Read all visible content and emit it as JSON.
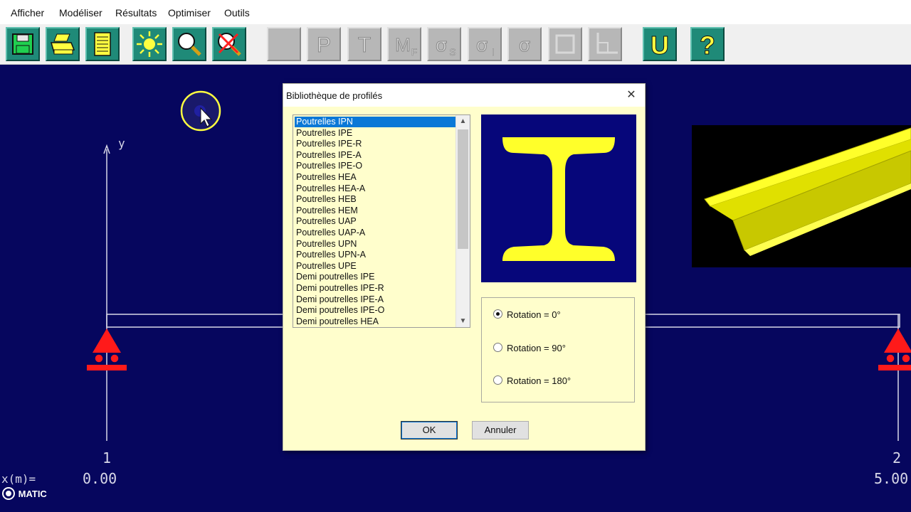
{
  "menu": {
    "items": [
      "Afficher",
      "Modéliser",
      "Résultats",
      "Optimiser",
      "Outils"
    ]
  },
  "toolbar": {
    "buttons": [
      "save-icon",
      "print-icon",
      "notes-icon",
      "sun-icon",
      "zoom-icon",
      "delete-zoom-icon",
      "blank-icon",
      "P",
      "T",
      "MF",
      "σS",
      "σI",
      "σ",
      "section-icon",
      "axes-icon",
      "U",
      "?"
    ]
  },
  "canvas": {
    "axis_label": "y",
    "node_left": "1",
    "node_right": "2",
    "x_label": "x(m)=",
    "x_left": "0.00",
    "x_right": "5.00",
    "badge": "MATIC"
  },
  "dialog": {
    "title": "Bibliothèque de profilés",
    "close": "✕",
    "profiles": [
      "Poutrelles IPN",
      "Poutrelles IPE",
      "Poutrelles IPE-R",
      "Poutrelles IPE-A",
      "Poutrelles IPE-O",
      "Poutrelles HEA",
      "Poutrelles HEA-A",
      "Poutrelles HEB",
      "Poutrelles HEM",
      "Poutrelles UAP",
      "Poutrelles UAP-A",
      "Poutrelles UPN",
      "Poutrelles UPN-A",
      "Poutrelles UPE",
      "Demi poutrelles IPE",
      "Demi poutrelles IPE-R",
      "Demi poutrelles IPE-A",
      "Demi poutrelles IPE-O",
      "Demi poutrelles HEA"
    ],
    "selected_profile": "Poutrelles IPN",
    "rotations": [
      "Rotation = 0°",
      "Rotation = 90°",
      "Rotation = 180°"
    ],
    "selected_rotation": "Rotation = 0°",
    "ok": "OK",
    "cancel": "Annuler"
  },
  "colors": {
    "background": "#06065e",
    "section_fill": "#ffff2a",
    "support": "#ff1a1a",
    "toolbar_button": "#1f8a78"
  }
}
